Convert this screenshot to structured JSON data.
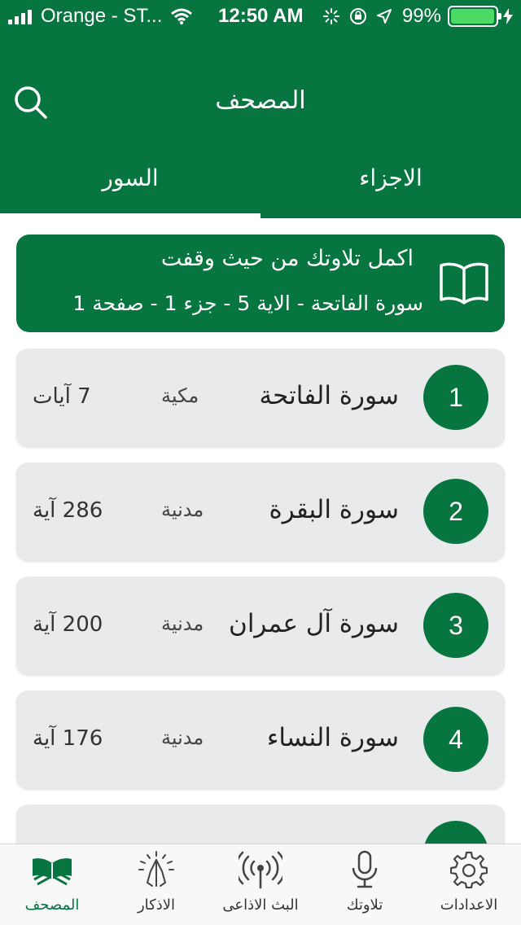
{
  "status_bar": {
    "carrier": "Orange - ST...",
    "time": "12:50 AM",
    "battery_percent": "99%",
    "battery_level": 0.99
  },
  "header": {
    "title": "المصحف",
    "search_icon": "search-icon"
  },
  "tabs": [
    {
      "label": "الاجزاء",
      "active": false
    },
    {
      "label": "السور",
      "active": true
    }
  ],
  "continue_card": {
    "title": "اكمل تلاوتك من حيث وقفت",
    "subtitle": "سورة الفاتحة - الاية 5 - جزء 1 - صفحة 1",
    "icon": "open-book-icon"
  },
  "surahs": [
    {
      "number": "1",
      "name": "سورة الفاتحة",
      "type": "مكية",
      "verses": "7 آيات"
    },
    {
      "number": "2",
      "name": "سورة البقرة",
      "type": "مدنية",
      "verses": "286 آية"
    },
    {
      "number": "3",
      "name": "سورة آل عمران",
      "type": "مدنية",
      "verses": "200 آية"
    },
    {
      "number": "4",
      "name": "سورة النساء",
      "type": "مدنية",
      "verses": "176 آية"
    }
  ],
  "bottom_nav": [
    {
      "label": "المصحف",
      "icon": "quran-icon",
      "active": true
    },
    {
      "label": "الاذكار",
      "icon": "praying-hands-icon",
      "active": false
    },
    {
      "label": "البث الاذاعى",
      "icon": "radio-broadcast-icon",
      "active": false
    },
    {
      "label": "تلاوتك",
      "icon": "microphone-icon",
      "active": false
    },
    {
      "label": "الاعدادات",
      "icon": "gear-icon",
      "active": false
    }
  ],
  "colors": {
    "primary_green": "#077540",
    "card_gray": "#e8eaeb",
    "battery_green": "#4cd964"
  }
}
